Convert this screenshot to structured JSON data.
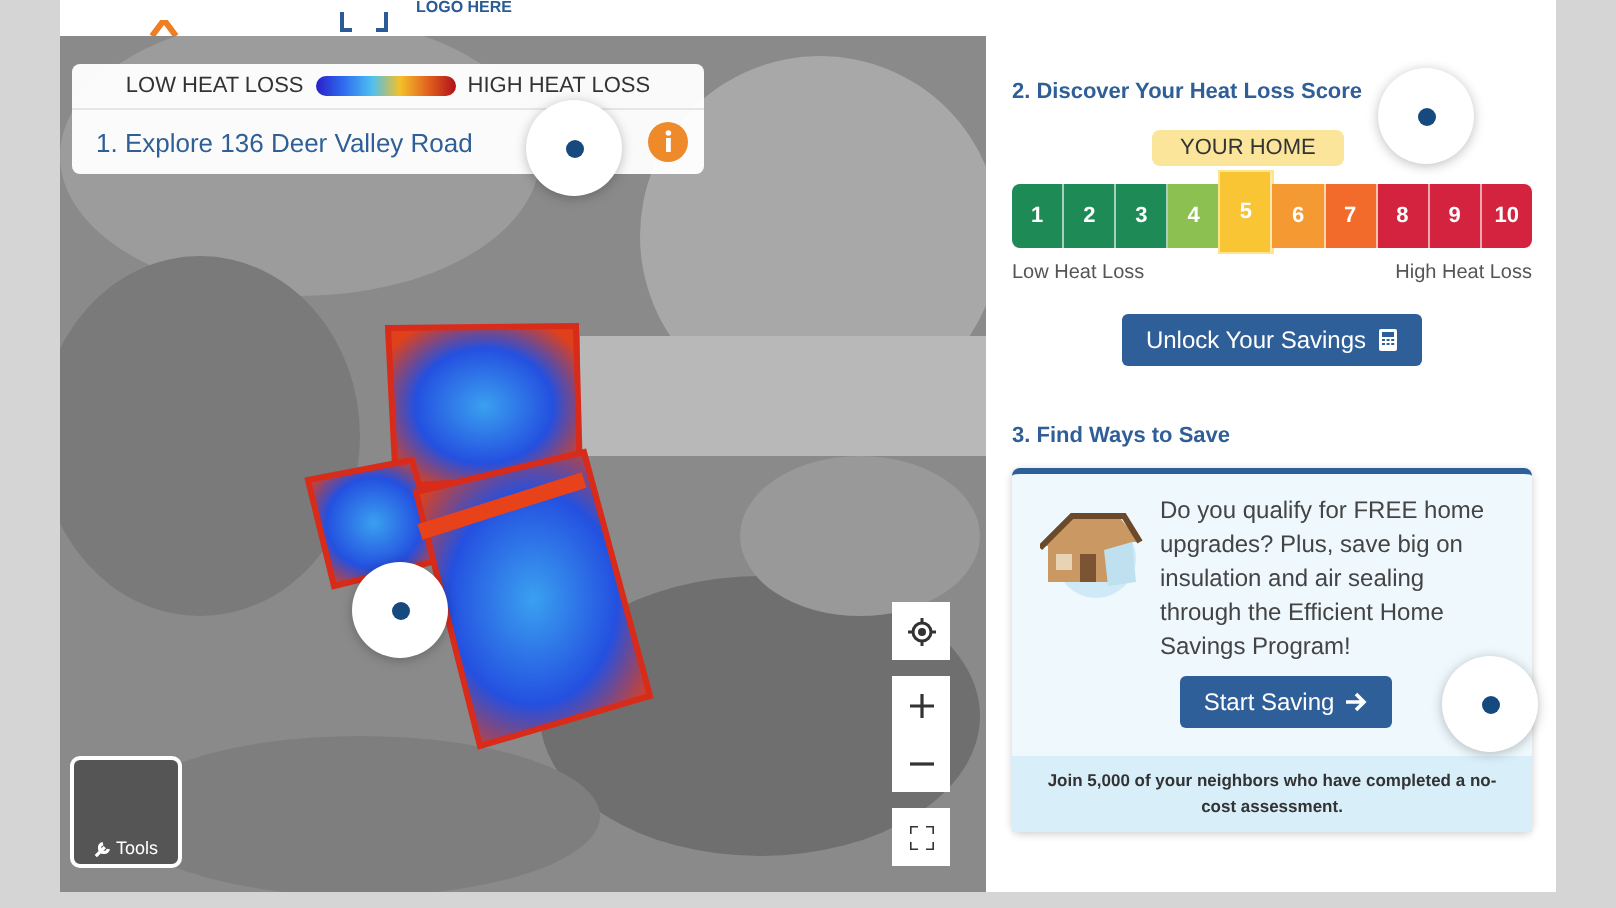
{
  "header": {
    "logo_text": "LOGO HERE"
  },
  "map": {
    "legend": {
      "low": "LOW HEAT LOSS",
      "high": "HIGH HEAT LOSS"
    },
    "title": "1. Explore 136 Deer Valley Road",
    "tools_label": "Tools"
  },
  "score": {
    "title": "2. Discover Your Heat Loss Score",
    "badge": "YOUR HOME",
    "segments": [
      {
        "label": "1",
        "color": "#1e8a55",
        "selected": false
      },
      {
        "label": "2",
        "color": "#1e8a55",
        "selected": false
      },
      {
        "label": "3",
        "color": "#1e8a55",
        "selected": false
      },
      {
        "label": "4",
        "color": "#8cc152",
        "selected": false
      },
      {
        "label": "5",
        "color": "#f9c535",
        "selected": true
      },
      {
        "label": "6",
        "color": "#f59a33",
        "selected": false
      },
      {
        "label": "7",
        "color": "#f26b2a",
        "selected": false
      },
      {
        "label": "8",
        "color": "#d3233f",
        "selected": false
      },
      {
        "label": "9",
        "color": "#d3233f",
        "selected": false
      },
      {
        "label": "10",
        "color": "#d3233f",
        "selected": false
      }
    ],
    "low_label": "Low Heat Loss",
    "high_label": "High Heat Loss",
    "button": "Unlock Your Savings"
  },
  "save": {
    "title": "3. Find Ways to Save",
    "body": "Do you qualify for FREE home upgrades? Plus, save big on insulation and air sealing through the Efficient Home Savings Program!",
    "button": "Start Saving",
    "footer": "Join 5,000 of your neighbors who have completed a no-cost assessment."
  }
}
